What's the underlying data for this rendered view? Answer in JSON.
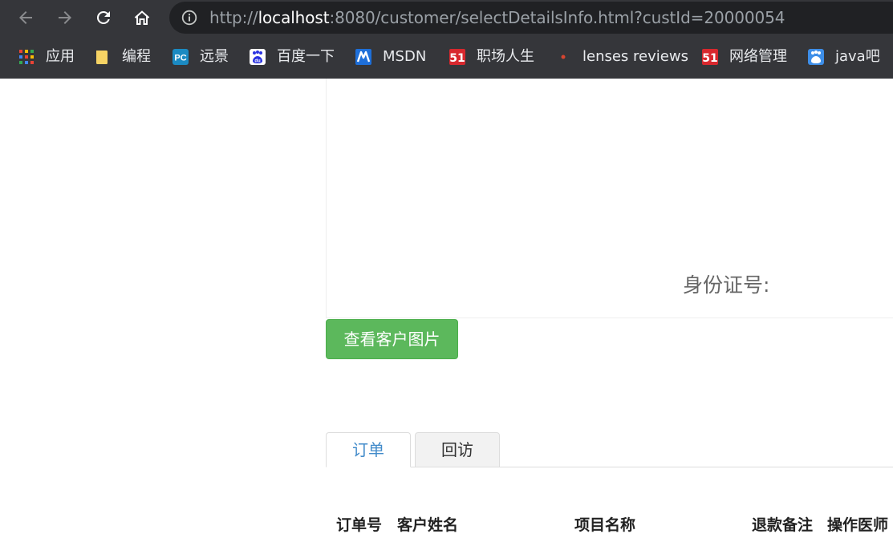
{
  "browser": {
    "url_scheme": "http://",
    "url_host": "localhost",
    "url_path": ":8080/customer/selectDetailsInfo.html?custId=20000054",
    "bookmarks": [
      {
        "label": "应用",
        "icon": "apps-grid-icon"
      },
      {
        "label": "编程",
        "icon": "folder-icon"
      },
      {
        "label": "远景",
        "icon": "pc-site-icon"
      },
      {
        "label": "百度一下",
        "icon": "baidu-paw-icon"
      },
      {
        "label": "MSDN",
        "icon": "msdn-icon"
      },
      {
        "label": "职场人生",
        "icon": "51cto-icon"
      },
      {
        "label": "lenses reviews",
        "icon": "red-dot-icon"
      },
      {
        "label": "网络管理",
        "icon": "51cto-icon"
      },
      {
        "label": "java吧",
        "icon": "baidu-paw-icon"
      }
    ]
  },
  "customer": {
    "id_card_label": "身份证号:",
    "view_images_button": "查看客户图片"
  },
  "tabs": [
    {
      "label": "订单",
      "active": true
    },
    {
      "label": "回访",
      "active": false
    }
  ],
  "orders_table": {
    "headers": [
      "订单号",
      "客户姓名",
      "项目名称",
      "退款备注",
      "操作医师"
    ]
  },
  "colors": {
    "chrome_bg": "#35363a",
    "omnibox_bg": "#202124",
    "button_success": "#5cb85c",
    "tab_active_text": "#428bca"
  }
}
